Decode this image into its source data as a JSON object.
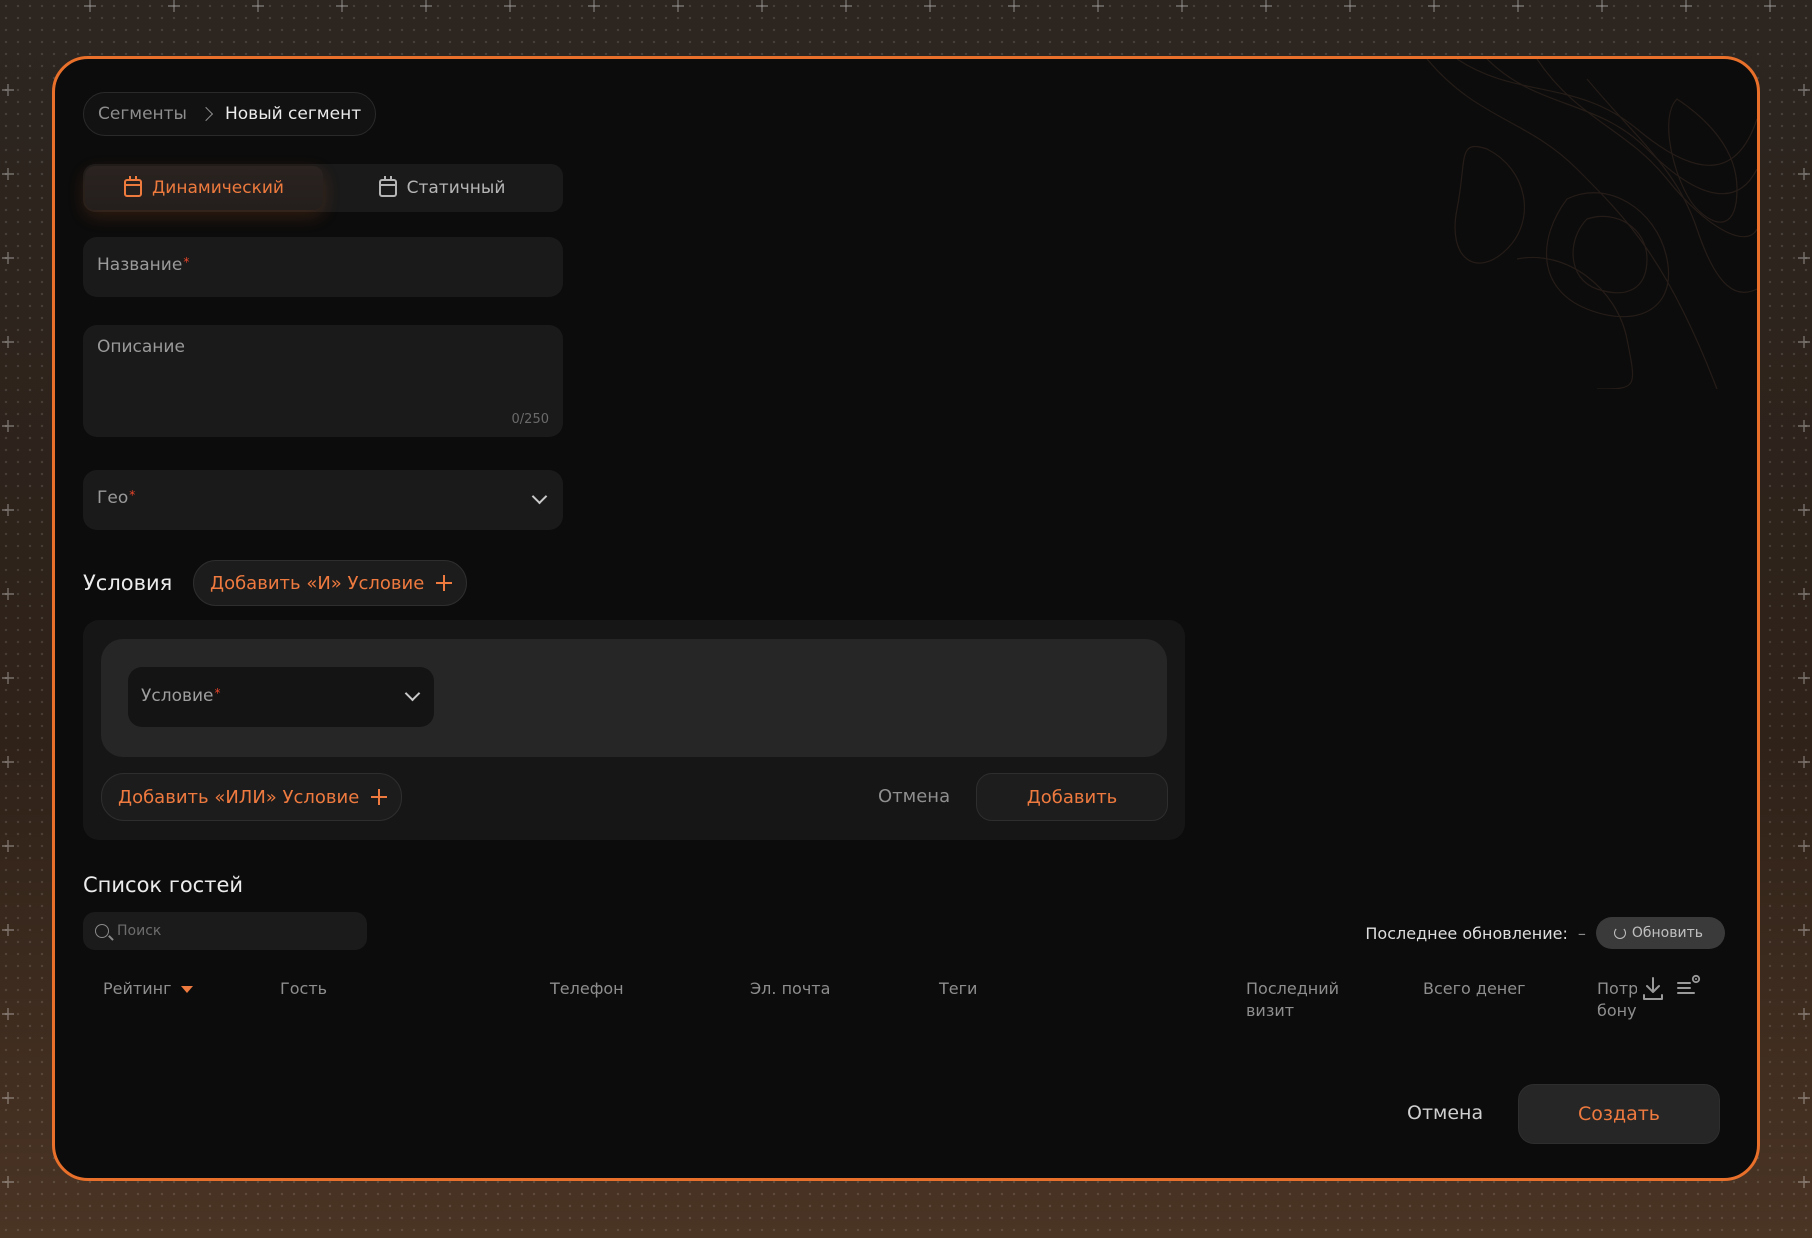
{
  "breadcrumb": {
    "parent": "Сегменты",
    "current": "Новый сегмент"
  },
  "tabs": [
    {
      "label": "Динамический",
      "active": true,
      "icon": "calendar-icon"
    },
    {
      "label": "Статичный",
      "active": false,
      "icon": "calendar-icon"
    }
  ],
  "form": {
    "name_label": "Название",
    "description_label": "Описание",
    "description_counter": "0/250",
    "geo_label": "Гео",
    "required_mark": "*"
  },
  "conditions": {
    "title": "Условия",
    "add_and_label": "Добавить «И» Условие",
    "condition_select_label": "Условие",
    "add_or_label": "Добавить «ИЛИ» Условие",
    "cancel_label": "Отмена",
    "add_label": "Добавить"
  },
  "guests": {
    "title": "Список гостей",
    "search_placeholder": "Поиск",
    "last_update_label": "Последнее обновление:",
    "last_update_value": "–",
    "refresh_label": "Обновить",
    "columns": {
      "rating": "Рейтинг",
      "guest": "Гость",
      "phone": "Телефон",
      "email": "Эл. почта",
      "tags": "Теги",
      "last_visit_1": "Последний",
      "last_visit_2": "визит",
      "total_money": "Всего денег",
      "bonus_1": "Потр",
      "bonus_2": "бону"
    }
  },
  "footer": {
    "cancel_label": "Отмена",
    "create_label": "Создать"
  },
  "colors": {
    "accent": "#ef7a3f",
    "frame": "#e8702a",
    "background": "#0c0c0c",
    "required": "#e8452a"
  }
}
